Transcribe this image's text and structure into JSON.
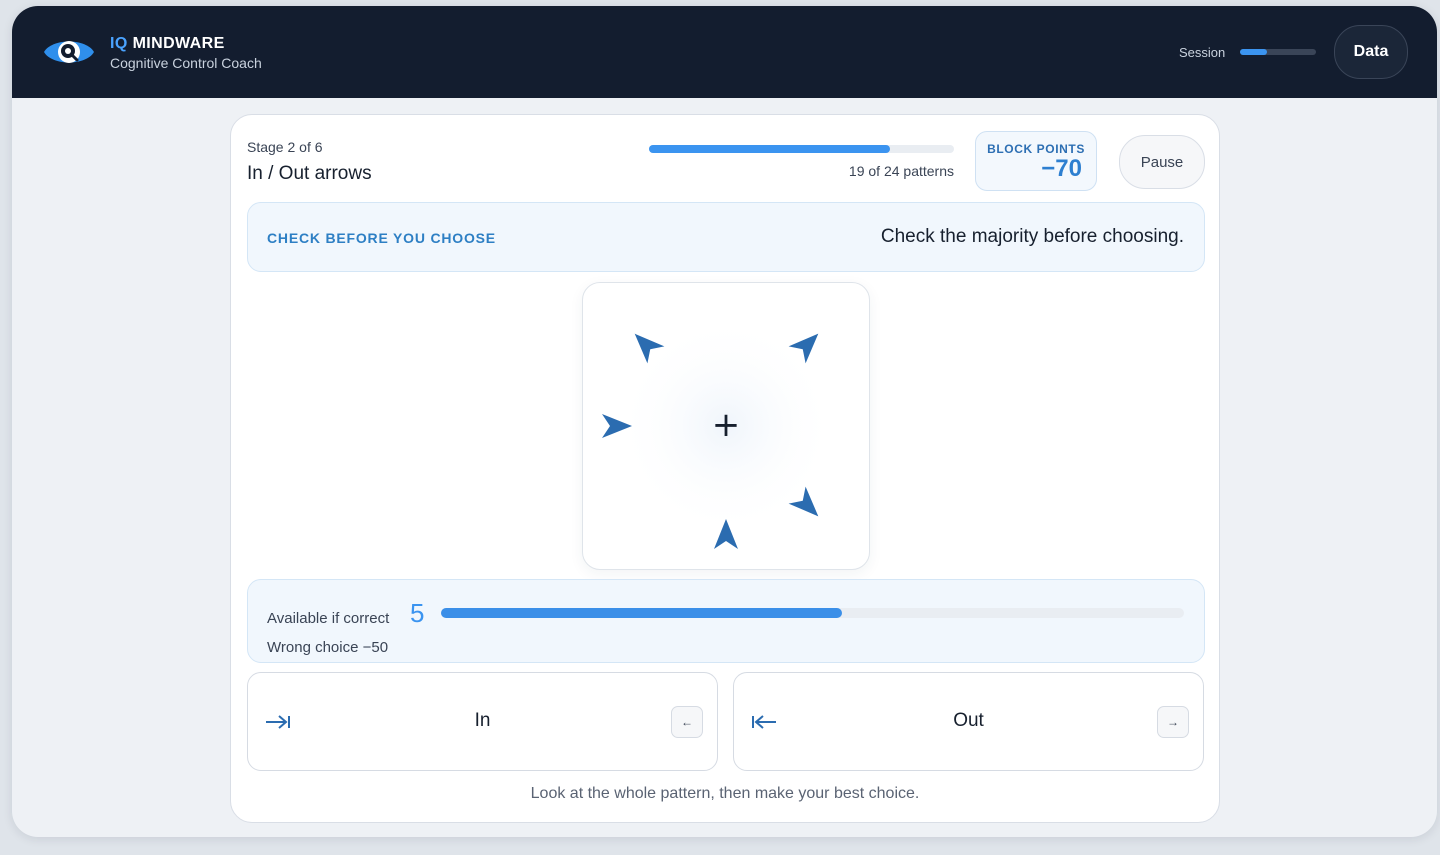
{
  "header": {
    "brand_prefix": "IQ",
    "brand_name": "MINDWARE",
    "subtitle": "Cognitive Control Coach",
    "session_label": "Session",
    "session_progress": 0.35,
    "data_button": "Data"
  },
  "block": {
    "stage_label": "Stage 2 of 6",
    "title": "In / Out arrows",
    "progress_text": "19 of 24 patterns",
    "progress_fraction": 0.7917,
    "points_label": "BLOCK POINTS",
    "points_value": "−70",
    "pause_label": "Pause"
  },
  "hint": {
    "label": "CHECK BEFORE YOU CHOOSE",
    "text": "Check the majority before choosing."
  },
  "stimulus": {
    "fixation": "+",
    "arrow_color": "#2b6cb0"
  },
  "reward": {
    "available_label": "Available if correct",
    "available_value": "5",
    "available_fraction": 0.54,
    "wrong_label": "Wrong choice −50"
  },
  "choices": {
    "in": {
      "label": "In",
      "icon": "arrow-right-to-bar-icon",
      "key": "←"
    },
    "out": {
      "label": "Out",
      "icon": "arrow-left-from-bar-icon",
      "key": "→"
    }
  },
  "footer": {
    "text": "Look at the whole pattern, then make your best choice."
  },
  "colors": {
    "topbar": "#131d2f",
    "accent": "#3b94f0",
    "points": "#2d7fd0"
  }
}
